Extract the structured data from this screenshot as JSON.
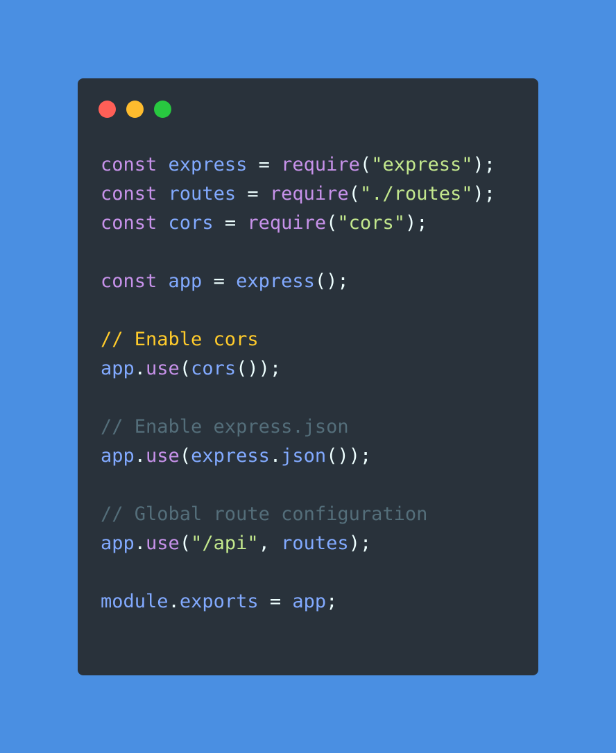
{
  "window": {
    "controls": [
      {
        "name": "close",
        "color": "#ff5f57"
      },
      {
        "name": "minimize",
        "color": "#febc2e"
      },
      {
        "name": "maximize",
        "color": "#28c840"
      }
    ]
  },
  "theme": {
    "keyword": "#c792ea",
    "identifier": "#82aaff",
    "string": "#c3e88d",
    "punctuation": "#eeffff",
    "comment_highlight": "#ffcb2b",
    "comment": "#546e7a"
  },
  "code_lines": [
    [
      {
        "t": "const",
        "k": "keyword"
      },
      {
        "t": " ",
        "k": "punctuation"
      },
      {
        "t": "express",
        "k": "identifier"
      },
      {
        "t": " = ",
        "k": "punctuation"
      },
      {
        "t": "require",
        "k": "keyword"
      },
      {
        "t": "(",
        "k": "punctuation"
      },
      {
        "t": "\"express\"",
        "k": "string"
      },
      {
        "t": ");",
        "k": "punctuation"
      }
    ],
    [
      {
        "t": "const",
        "k": "keyword"
      },
      {
        "t": " ",
        "k": "punctuation"
      },
      {
        "t": "routes",
        "k": "identifier"
      },
      {
        "t": " = ",
        "k": "punctuation"
      },
      {
        "t": "require",
        "k": "keyword"
      },
      {
        "t": "(",
        "k": "punctuation"
      },
      {
        "t": "\"./routes\"",
        "k": "string"
      },
      {
        "t": ");",
        "k": "punctuation"
      }
    ],
    [
      {
        "t": "const",
        "k": "keyword"
      },
      {
        "t": " ",
        "k": "punctuation"
      },
      {
        "t": "cors",
        "k": "identifier"
      },
      {
        "t": " = ",
        "k": "punctuation"
      },
      {
        "t": "require",
        "k": "keyword"
      },
      {
        "t": "(",
        "k": "punctuation"
      },
      {
        "t": "\"cors\"",
        "k": "string"
      },
      {
        "t": ");",
        "k": "punctuation"
      }
    ],
    [],
    [
      {
        "t": "const",
        "k": "keyword"
      },
      {
        "t": " ",
        "k": "punctuation"
      },
      {
        "t": "app",
        "k": "identifier"
      },
      {
        "t": " = ",
        "k": "punctuation"
      },
      {
        "t": "express",
        "k": "identifier"
      },
      {
        "t": "();",
        "k": "punctuation"
      }
    ],
    [],
    [
      {
        "t": "// Enable cors",
        "k": "comment_highlight"
      }
    ],
    [
      {
        "t": "app",
        "k": "identifier"
      },
      {
        "t": ".",
        "k": "punctuation"
      },
      {
        "t": "use",
        "k": "keyword"
      },
      {
        "t": "(",
        "k": "punctuation"
      },
      {
        "t": "cors",
        "k": "identifier"
      },
      {
        "t": "());",
        "k": "punctuation"
      }
    ],
    [],
    [
      {
        "t": "// Enable express.json",
        "k": "comment"
      }
    ],
    [
      {
        "t": "app",
        "k": "identifier"
      },
      {
        "t": ".",
        "k": "punctuation"
      },
      {
        "t": "use",
        "k": "keyword"
      },
      {
        "t": "(",
        "k": "punctuation"
      },
      {
        "t": "express",
        "k": "identifier"
      },
      {
        "t": ".",
        "k": "punctuation"
      },
      {
        "t": "json",
        "k": "identifier"
      },
      {
        "t": "());",
        "k": "punctuation"
      }
    ],
    [],
    [
      {
        "t": "// Global route configuration",
        "k": "comment"
      }
    ],
    [
      {
        "t": "app",
        "k": "identifier"
      },
      {
        "t": ".",
        "k": "punctuation"
      },
      {
        "t": "use",
        "k": "keyword"
      },
      {
        "t": "(",
        "k": "punctuation"
      },
      {
        "t": "\"/api\"",
        "k": "string"
      },
      {
        "t": ", ",
        "k": "punctuation"
      },
      {
        "t": "routes",
        "k": "identifier"
      },
      {
        "t": ");",
        "k": "punctuation"
      }
    ],
    [],
    [
      {
        "t": "module",
        "k": "identifier"
      },
      {
        "t": ".",
        "k": "punctuation"
      },
      {
        "t": "exports",
        "k": "identifier"
      },
      {
        "t": " = ",
        "k": "punctuation"
      },
      {
        "t": "app",
        "k": "identifier"
      },
      {
        "t": ";",
        "k": "punctuation"
      }
    ]
  ]
}
